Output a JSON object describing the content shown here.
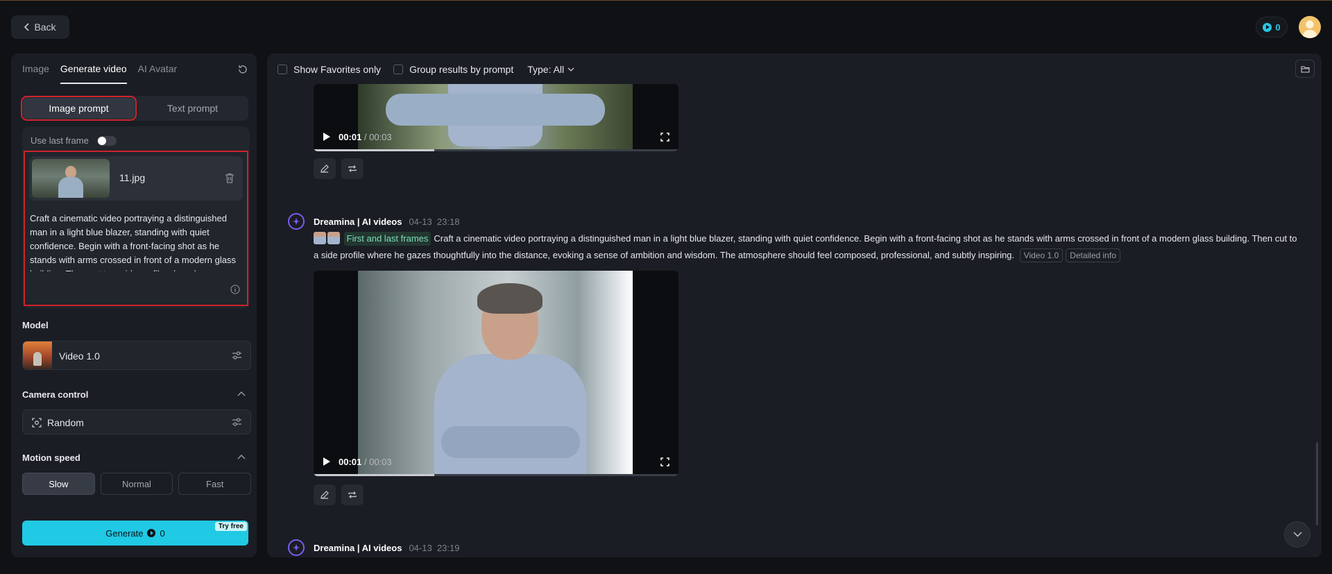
{
  "header": {
    "back_label": "Back",
    "credits": "0"
  },
  "left": {
    "tabs": [
      {
        "label": "Image"
      },
      {
        "label": "Generate video"
      },
      {
        "label": "AI Avatar"
      }
    ],
    "prompt_modes": {
      "image": "Image prompt",
      "text": "Text prompt"
    },
    "use_last_frame": "Use last frame",
    "file_name": "11.jpg",
    "prompt": "Craft a cinematic video portraying a distinguished man in a light blue blazer, standing with quiet confidence. Begin with a front-facing shot as he stands with arms crossed in front of a modern glass building. Then cut to a side profile where he gazes thoughtfully into the distance, evoking a sense of ambition and wisdom.",
    "model_label": "Model",
    "model_name": "Video 1.0",
    "camera_label": "Camera control",
    "camera_value": "Random",
    "motion_label": "Motion speed",
    "speeds": [
      "Slow",
      "Normal",
      "Fast"
    ],
    "generate_label": "Generate",
    "generate_cost": "0",
    "try_free": "Try free"
  },
  "filters": {
    "favorites": "Show Favorites only",
    "group": "Group results by prompt",
    "type": "Type: All"
  },
  "results": {
    "video_top": {
      "current": "00:01",
      "duration": "/ 00:03",
      "progress": 0.33
    },
    "message": {
      "bot": "Dreamina | AI videos",
      "date": "04-13",
      "time": "23:18",
      "tag": "First and last frames",
      "text": "Craft a cinematic video portraying a distinguished man in a light blue blazer, standing with quiet confidence. Begin with a front-facing shot as he stands with arms crossed in front of a modern glass building. Then cut to a side profile where he gazes thoughtfully into the distance, evoking a sense of ambition and wisdom. The atmosphere should feel composed, professional, and subtly inspiring.",
      "chip_model": "Video 1.0",
      "chip_info": "Detailed info"
    },
    "video_main": {
      "current": "00:01",
      "duration": "/ 00:03",
      "progress": 0.33
    },
    "message2": {
      "bot": "Dreamina | AI videos",
      "date": "04-13",
      "time": "23:19"
    }
  },
  "colors": {
    "accent": "#20c9e4",
    "highlight": "#d0232a",
    "bot": "#7b5cf0"
  }
}
